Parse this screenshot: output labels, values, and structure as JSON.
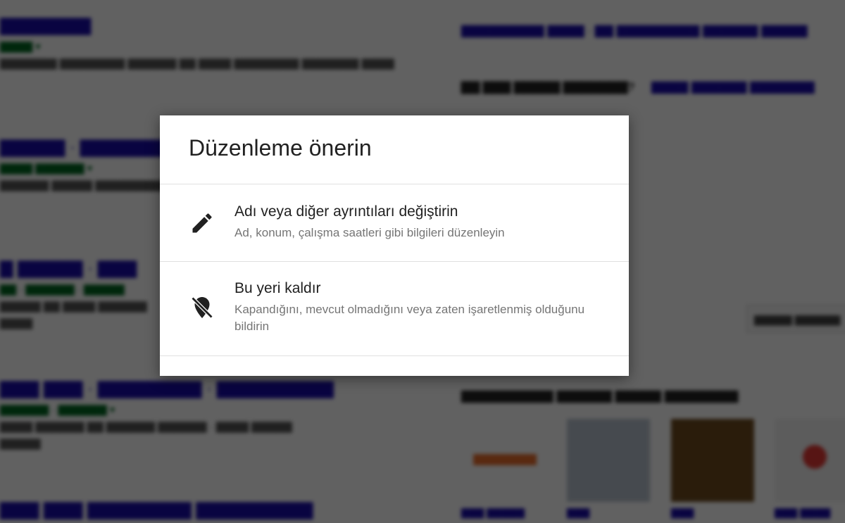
{
  "dialog": {
    "title": "Düzenleme önerin",
    "options": [
      {
        "label": "Adı veya diğer ayrıntıları değiştirin",
        "description": "Ad, konum, çalışma saatleri gibi bilgileri düzenleyin",
        "icon": "pencil-icon"
      },
      {
        "label": "Bu yeri kaldır",
        "description": "Kapandığını, mevcut olmadığını veya zaten işaretlenmiş olduğunu bildirin",
        "icon": "location-off-icon"
      }
    ]
  },
  "colors": {
    "overlay": "#000000",
    "dialog_bg": "#ffffff",
    "primary_text": "#212121",
    "secondary_text": "#757575",
    "divider": "#e0e0e0"
  }
}
